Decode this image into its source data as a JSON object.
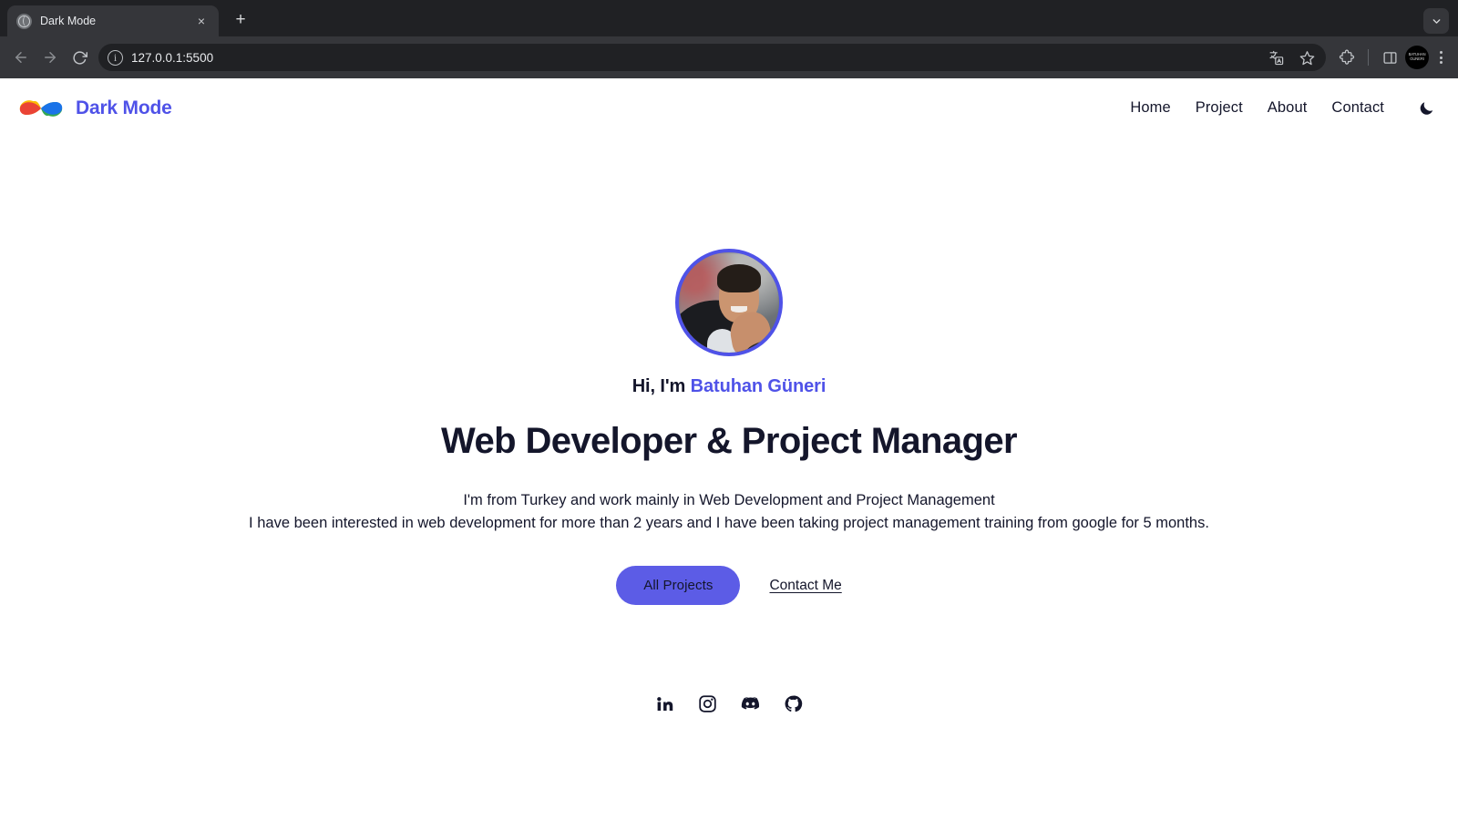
{
  "browser": {
    "tab": {
      "title": "Dark Mode",
      "favicon_icon": "globe-icon",
      "close_icon": "×"
    },
    "new_tab_label": "+",
    "tab_search_icon": "chevron-down-icon",
    "toolbar": {
      "back_icon": "arrow-left-icon",
      "forward_icon": "arrow-right-icon",
      "reload_icon": "reload-icon",
      "site_info_icon": "info-icon",
      "url": "127.0.0.1:5500",
      "translate_icon": "translate-icon",
      "bookmark_icon": "star-icon",
      "extensions_icon": "puzzle-piece-icon",
      "side_panel_icon": "side-panel-icon",
      "profile_label": "BATUHAN GUNERI",
      "menu_icon": "kebab-menu-icon"
    }
  },
  "site": {
    "brand": {
      "name": "Dark Mode",
      "logo_icon": "google-style-petals-logo",
      "logo_colors": [
        "#EA4335",
        "#FBBC05",
        "#34A853",
        "#1A73E8"
      ],
      "name_color": "#4f52e8"
    },
    "nav": {
      "items": [
        {
          "label": "Home"
        },
        {
          "label": "Project"
        },
        {
          "label": "About"
        },
        {
          "label": "Contact"
        }
      ],
      "theme_toggle_icon": "moon-icon"
    },
    "hero": {
      "avatar_alt": "Portrait of Batuhan Güneri",
      "greeting_prefix": "Hi, I'm ",
      "greeting_name": "Batuhan Güneri",
      "title": "Web Developer & Project Manager",
      "paragraph_line_1": "I'm from Turkey and work mainly in Web Development and Project Management",
      "paragraph_line_2": "I have been interested in web development for more than 2 years and I have been taking project management training from google for 5 months.",
      "primary_button": "All Projects",
      "secondary_link": "Contact Me",
      "accent_color": "#4f52e8",
      "button_color": "#5c5ce6",
      "text_color": "#14162b"
    },
    "socials": [
      {
        "name": "linkedin",
        "icon": "linkedin-icon"
      },
      {
        "name": "instagram",
        "icon": "instagram-icon"
      },
      {
        "name": "discord",
        "icon": "discord-icon"
      },
      {
        "name": "github",
        "icon": "github-icon"
      }
    ]
  }
}
